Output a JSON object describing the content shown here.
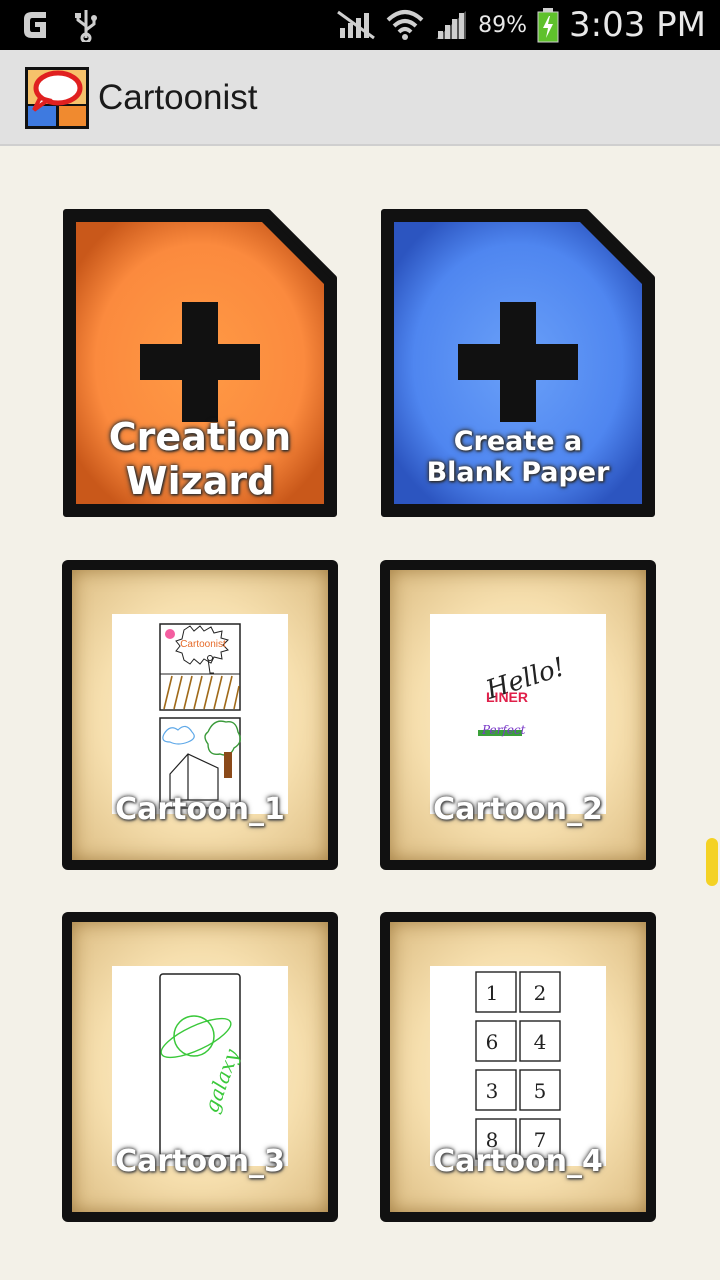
{
  "status_bar": {
    "battery": "89%",
    "time": "3:03 PM",
    "icons": [
      "sync-icon",
      "usb-icon",
      "mute-icon",
      "wifi-icon",
      "signal-icon",
      "battery-icon"
    ]
  },
  "action_bar": {
    "title": "Cartoonist"
  },
  "create": {
    "wizard_line1": "Creation",
    "wizard_line2": "Wizard",
    "blank_line1": "Create a",
    "blank_line2": "Blank Paper",
    "wizard_color": "#ff8a3d",
    "blank_color": "#4f86f0"
  },
  "cartoons": [
    {
      "label": "Cartoon_1"
    },
    {
      "label": "Cartoon_2"
    },
    {
      "label": "Cartoon_3"
    },
    {
      "label": "Cartoon_4"
    }
  ],
  "thumb_text": {
    "c1_bubble": "Cartoonist",
    "c2_hello": "Hello!",
    "c2_line": "LINER",
    "c2_perfect": "Perfect",
    "c3_galaxy": "galaxy",
    "c4_numbers": [
      "1",
      "2",
      "6",
      "4",
      "3",
      "5",
      "8",
      "7"
    ]
  },
  "accent_scroll": "#f4d224"
}
